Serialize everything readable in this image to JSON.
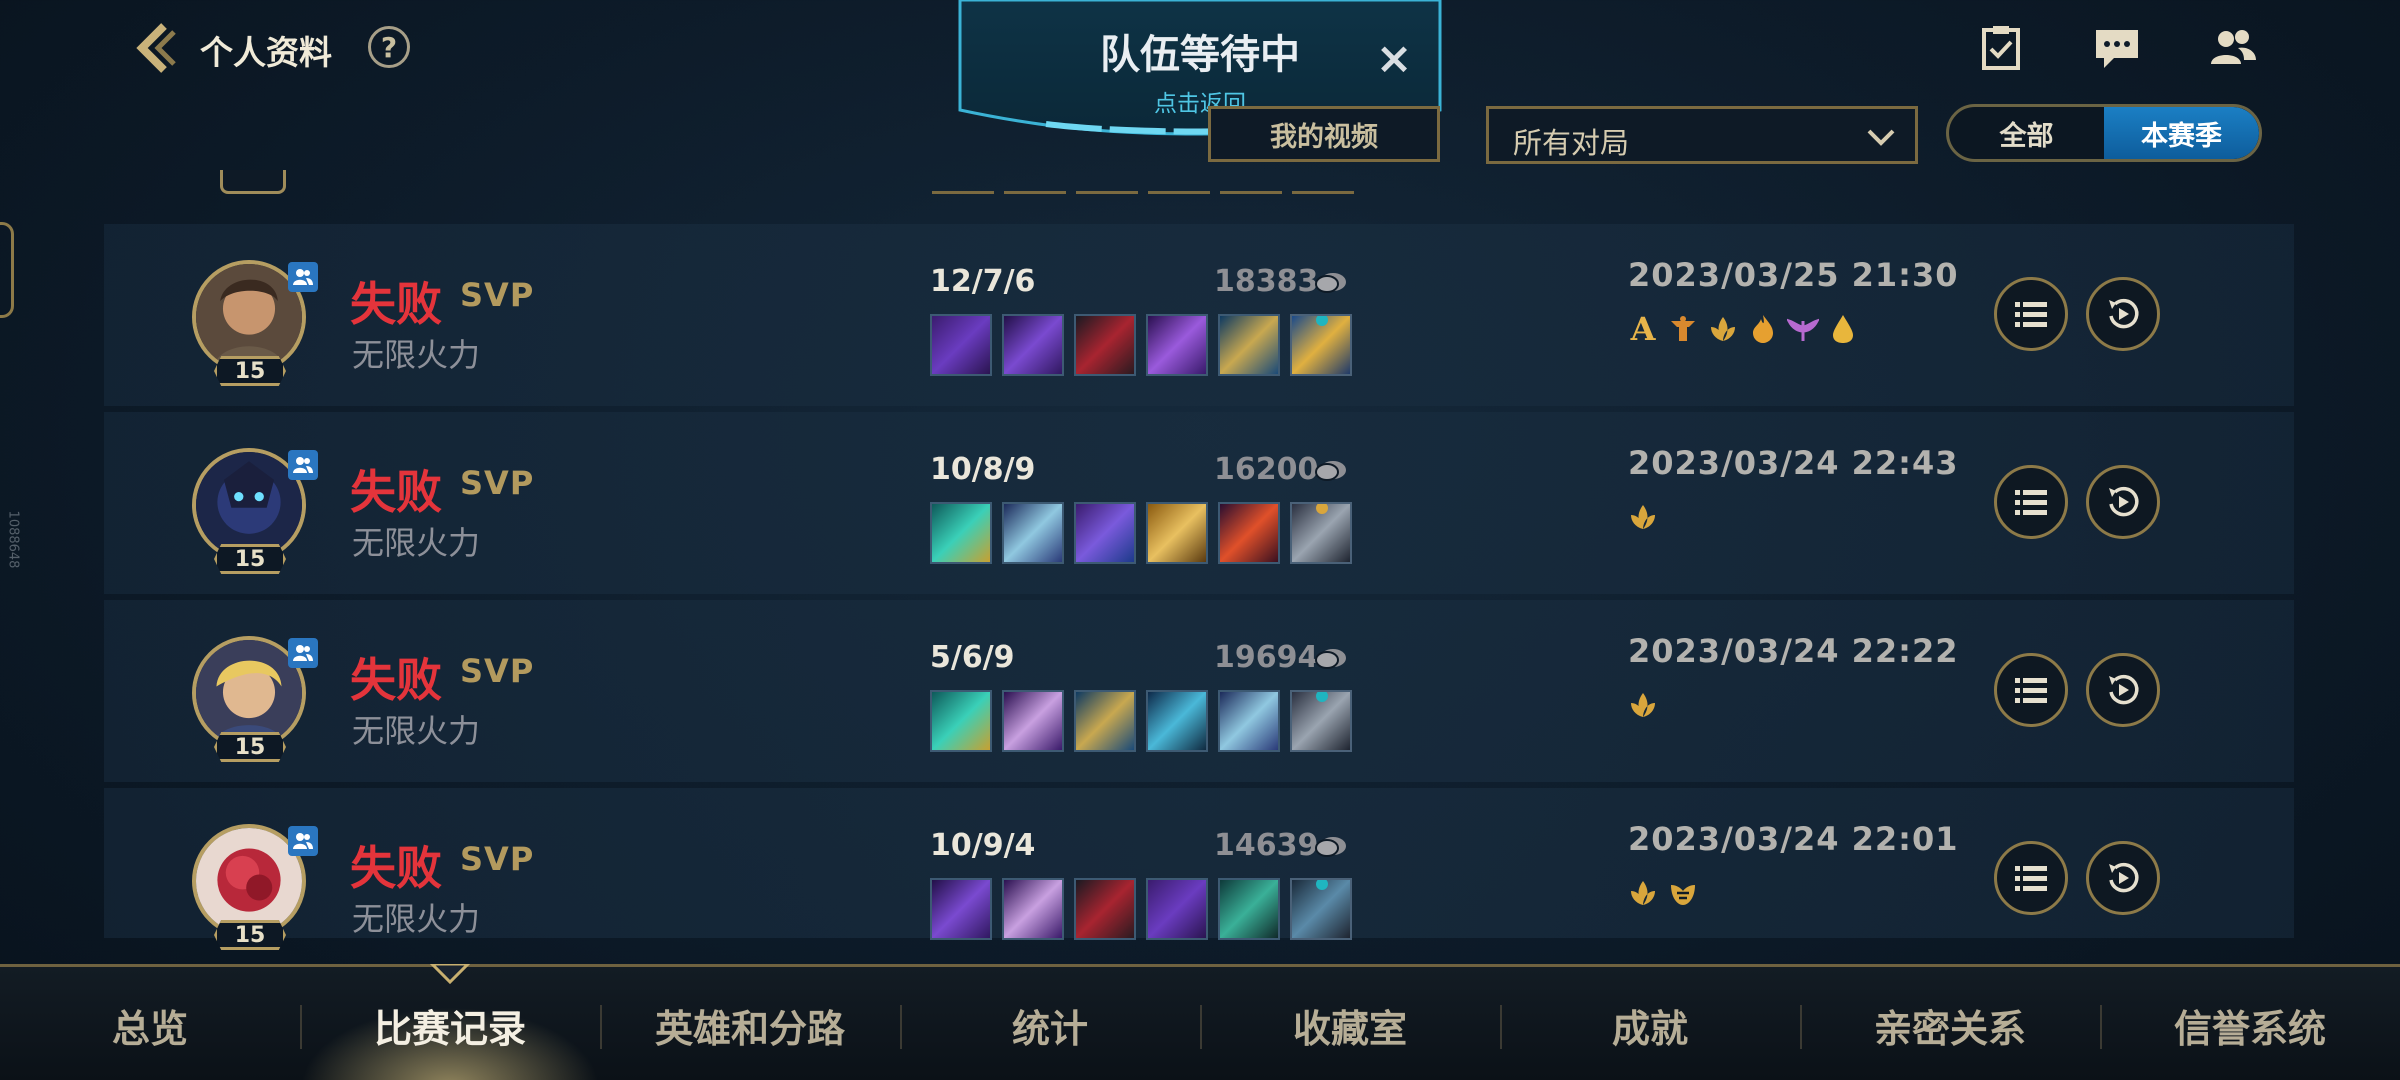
{
  "header": {
    "title": "个人资料",
    "help": "?"
  },
  "queue": {
    "title": "队伍等待中",
    "subtitle": "点击返回",
    "close": "×"
  },
  "filters": {
    "video_label": "我的视频",
    "mode_select": "所有对局",
    "season_options": [
      "全部",
      "本赛季"
    ],
    "season_selected": "本赛季"
  },
  "side_id": "1088648",
  "matches": [
    {
      "result": "失败",
      "svp": "SVP",
      "mode": "无限火力",
      "level": "15",
      "kda": "12/7/6",
      "gold": "18383",
      "date": "2023/03/25 21:30",
      "badges": [
        "A",
        "turret",
        "lotus",
        "flame",
        "wings",
        "drop"
      ]
    },
    {
      "result": "失败",
      "svp": "SVP",
      "mode": "无限火力",
      "level": "15",
      "kda": "10/8/9",
      "gold": "16200",
      "date": "2023/03/24 22:43",
      "badges": [
        "lotus"
      ]
    },
    {
      "result": "失败",
      "svp": "SVP",
      "mode": "无限火力",
      "level": "15",
      "kda": "5/6/9",
      "gold": "19694",
      "date": "2023/03/24 22:22",
      "badges": [
        "lotus"
      ]
    },
    {
      "result": "失败",
      "svp": "SVP",
      "mode": "无限火力",
      "level": "15",
      "kda": "10/9/4",
      "gold": "14639",
      "date": "2023/03/24 22:01",
      "badges": [
        "lotus",
        "lotus-outline"
      ]
    }
  ],
  "nav": {
    "tabs": [
      "总览",
      "比赛记录",
      "英雄和分路",
      "统计",
      "收藏室",
      "成就",
      "亲密关系",
      "信誉系统"
    ],
    "active": "比赛记录"
  },
  "colors": {
    "defeat": "#e4343b",
    "gold_trim": "#b69e62",
    "accent_blue": "#1b7fc4",
    "queue_cyan": "#4fc6e4"
  }
}
